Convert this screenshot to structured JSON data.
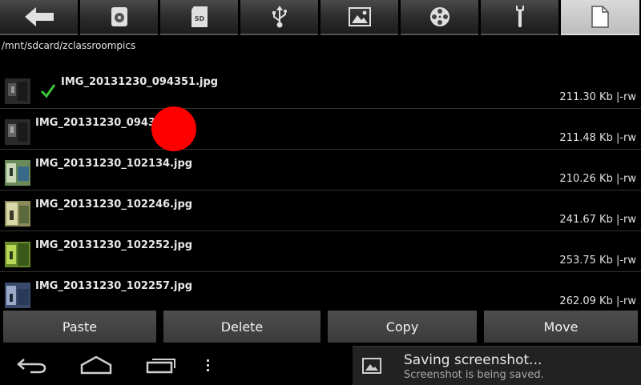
{
  "toolbar": {
    "buttons": [
      {
        "icon": "back-arrow-icon"
      },
      {
        "icon": "internal-storage-icon"
      },
      {
        "icon": "sd-card-icon",
        "label": "SD"
      },
      {
        "icon": "usb-icon"
      },
      {
        "icon": "image-gallery-icon"
      },
      {
        "icon": "video-reel-icon"
      },
      {
        "icon": "wrench-icon"
      },
      {
        "icon": "document-icon",
        "active": true
      }
    ]
  },
  "path": "/mnt/sdcard/zclassroompics",
  "files": [
    {
      "name": "IMG_20131230_094351.jpg",
      "size": "211.30 Kb  |-rw",
      "checked": true,
      "thumb": "dark"
    },
    {
      "name": "IMG_20131230_094353.jpg",
      "size": "211.48 Kb  |-rw",
      "checked": false,
      "thumb": "dark"
    },
    {
      "name": "IMG_20131230_102134.jpg",
      "size": "210.26 Kb  |-rw",
      "checked": false,
      "thumb": "green"
    },
    {
      "name": "IMG_20131230_102246.jpg",
      "size": "241.67 Kb  |-rw",
      "checked": false,
      "thumb": "olive"
    },
    {
      "name": "IMG_20131230_102252.jpg",
      "size": "253.75 Kb  |-rw",
      "checked": false,
      "thumb": "lime"
    },
    {
      "name": "IMG_20131230_102257.jpg",
      "size": "262.09 Kb  |-rw",
      "checked": false,
      "thumb": "blue"
    }
  ],
  "actions": {
    "paste": "Paste",
    "delete": "Delete",
    "copy": "Copy",
    "move": "Move"
  },
  "nav": {
    "back": "back-icon",
    "home": "home-icon",
    "recents": "recent-apps-icon",
    "menu": "overflow-menu-icon"
  },
  "notification": {
    "title": "Saving screenshot...",
    "subtitle": "Screenshot is being saved."
  },
  "colors": {
    "check": "#3cc43c",
    "overlay_dot": "#ff0000"
  }
}
